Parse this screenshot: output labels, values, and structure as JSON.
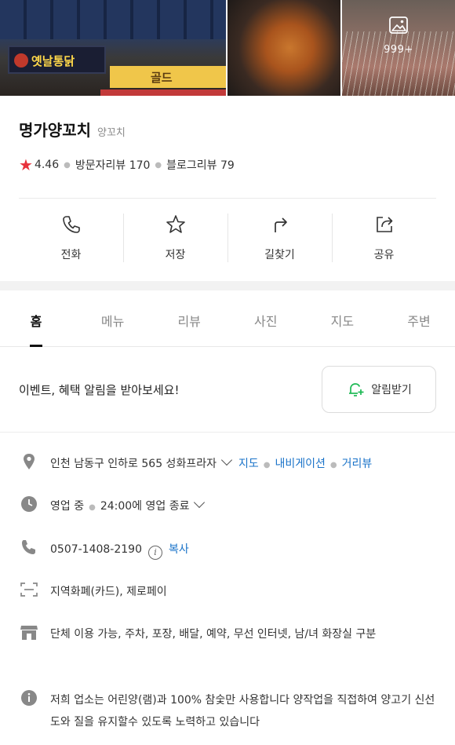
{
  "photos": {
    "sign_main": "옛날통닭",
    "sign_second": "골드",
    "count": "999+"
  },
  "place": {
    "name": "명가양꼬치",
    "category": "양꼬치",
    "rating": "4.46",
    "visitor_reviews": "방문자리뷰 170",
    "blog_reviews": "블로그리뷰 79"
  },
  "actions": [
    {
      "label": "전화",
      "icon": "phone-icon"
    },
    {
      "label": "저장",
      "icon": "star-outline-icon"
    },
    {
      "label": "길찾기",
      "icon": "directions-icon"
    },
    {
      "label": "공유",
      "icon": "share-icon"
    }
  ],
  "tabs": [
    "홈",
    "메뉴",
    "리뷰",
    "사진",
    "지도",
    "주변"
  ],
  "active_tab": "홈",
  "alert": {
    "text": "이벤트, 혜택 알림을 받아보세요!",
    "button_label": "알림받기"
  },
  "info": {
    "address": "인천 남동구 인하로 565 성화프라자",
    "address_links": [
      "지도",
      "내비게이션",
      "거리뷰"
    ],
    "hours_status": "영업 중",
    "hours_detail": "24:00에 영업 종료",
    "phone": "0507-1408-2190",
    "copy_label": "복사",
    "payment": "지역화폐(카드), 제로페이",
    "amenities": "단체 이용 가능, 주차, 포장, 배달, 예약, 무선 인터넷, 남/녀 화장실 구분",
    "description": "저희 업소는 어린양(램)과 100% 참숯만 사용합니다 양작업을 직접하여 양고기 신선도와 질을 유지할수 있도록 노력하고 있습니다"
  },
  "colors": {
    "star": "#e8323c",
    "link": "#1a73c9",
    "bell": "#1db954"
  }
}
